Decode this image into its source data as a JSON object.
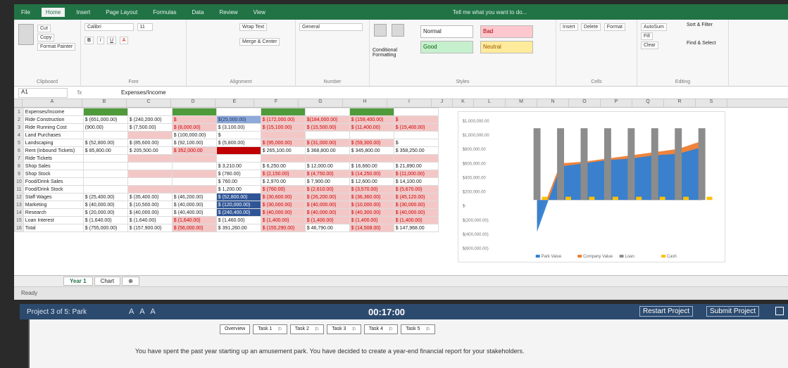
{
  "ribbon": {
    "tabs": [
      "File",
      "Home",
      "Insert",
      "Page Layout",
      "Formulas",
      "Data",
      "Review",
      "View"
    ],
    "tell_me": "Tell me what you want to do...",
    "clipboard": {
      "cut": "Cut",
      "copy": "Copy",
      "format_painter": "Format Painter",
      "label": "Clipboard"
    },
    "font": {
      "name": "Calibri",
      "size": "11",
      "label": "Font"
    },
    "alignment": {
      "wrap": "Wrap Text",
      "merge": "Merge & Center",
      "label": "Alignment"
    },
    "number": {
      "format": "General",
      "label": "Number"
    },
    "styles": {
      "conditional": "Conditional Formatting",
      "format_table": "Format as Table",
      "normal": "Normal",
      "bad": "Bad",
      "good": "Good",
      "neutral": "Neutral",
      "label": "Styles"
    },
    "cells": {
      "insert": "Insert",
      "delete": "Delete",
      "format": "Format",
      "label": "Cells"
    },
    "editing": {
      "autosum": "AutoSum",
      "fill": "Fill",
      "clear": "Clear",
      "sort": "Sort & Filter",
      "find": "Find & Select",
      "label": "Editing"
    }
  },
  "formula_bar": {
    "namebox": "A1",
    "fx": "fx",
    "content": "Expenses/Income"
  },
  "columns": [
    "A",
    "B",
    "C",
    "D",
    "E",
    "F",
    "G",
    "H",
    "I",
    "J",
    "K",
    "L",
    "M",
    "N",
    "O",
    "P",
    "Q",
    "R",
    "S"
  ],
  "sheet_rows": [
    {
      "n": "1",
      "label": "Expenses/Income",
      "cells": [
        "",
        "",
        "",
        "",
        "",
        "",
        "",
        ""
      ]
    },
    {
      "n": "2",
      "label": "Ride Construction",
      "cells": [
        "$ (651,000.00)",
        "$ (240,200.00)",
        "$",
        "$(25,000.00)",
        "$ (172,000.00)",
        "$(184,000.00)",
        "$ (159,400.00)",
        "$"
      ]
    },
    {
      "n": "3",
      "label": "Ride Running Cost",
      "cells": [
        "(900.00)",
        "$ (7,500.00)",
        "$ (8,000.00)",
        "$ (3,100.00)",
        "$ (15,100.00)",
        "$ (15,500.00)",
        "$ (11,400.00)",
        "$ (15,400.00)"
      ]
    },
    {
      "n": "4",
      "label": "Land Purchases",
      "cells": [
        "",
        "",
        "$ (100,000.00)",
        "$",
        "",
        "",
        "",
        ""
      ]
    },
    {
      "n": "5",
      "label": "Landscaping",
      "cells": [
        "$ (52,800.00)",
        "$ (85,600.00)",
        "$ (92,100.00)",
        "$ (5,800.00)",
        "$ (95,000.00)",
        "$ (31,000.00)",
        "$ (59,300.00)",
        "$"
      ]
    },
    {
      "n": "6",
      "label": "Rent (Inbound Tickets)",
      "cells": [
        "$ 85,800.00",
        "$ 205,500.00",
        "$ 352,000.00",
        "",
        "$ 265,100.00",
        "$ 368,800.00",
        "$ 345,800.00",
        "$ 358,250.00"
      ]
    },
    {
      "n": "7",
      "label": "Ride Tickets",
      "cells": [
        "",
        "",
        "",
        "",
        "",
        "",
        "",
        ""
      ]
    },
    {
      "n": "8",
      "label": "Shop Sales",
      "cells": [
        "",
        "",
        "",
        "$ 3,210.00",
        "$ 6,250.00",
        "$ 12,000.00",
        "$ 16,660.00",
        "$ 21,890.00"
      ]
    },
    {
      "n": "9",
      "label": "Shop Stock",
      "cells": [
        "",
        "",
        "",
        "$ (780.00)",
        "$ (2,150.00)",
        "$ (4,750.00)",
        "$ (14,250.00)",
        "$ (11,000.00)"
      ]
    },
    {
      "n": "10",
      "label": "Food/Drink Sales",
      "cells": [
        "",
        "",
        "",
        "$ 760.00",
        "$ 2,970.00",
        "$ 7,900.00",
        "$ 12,600.00",
        "$ 14,100.00"
      ]
    },
    {
      "n": "11",
      "label": "Food/Drink Stock",
      "cells": [
        "",
        "",
        "",
        "$ 1,200.00",
        "$ (760.00)",
        "$ (2,610.00)",
        "$ (3,570.00)",
        "$ (5,670.00)"
      ]
    },
    {
      "n": "12",
      "label": "Staff Wages",
      "cells": [
        "$ (25,400.00)",
        "$ (35,400.00)",
        "$ (46,200.00)",
        "$ (52,800.00)",
        "$ (30,600.00)",
        "$ (26,200.00)",
        "$ (36,360.00)",
        "$ (45,120.00)"
      ]
    },
    {
      "n": "13",
      "label": "Marketing",
      "cells": [
        "$ (40,000.00)",
        "$ (10,500.00)",
        "$ (40,000.00)",
        "$ (120,000.00)",
        "$ (30,000.00)",
        "$ (40,000.00)",
        "$ (10,000.00)",
        "$ (30,000.00)"
      ]
    },
    {
      "n": "14",
      "label": "Research",
      "cells": [
        "$ (20,000.00)",
        "$ (40,000.00)",
        "$ (40,400.00)",
        "$ (240,400.00)",
        "$ (40,000.00)",
        "$ (40,000.00)",
        "$ (40,300.00)",
        "$ (40,000.00)"
      ]
    },
    {
      "n": "15",
      "label": "Loan Interest",
      "cells": [
        "$ (1,640.00)",
        "$ (1,640.00)",
        "$ (1,640.00)",
        "$ (1,460.00)",
        "$ (1,400.00)",
        "$ (1,400.00)",
        "$ (1,400.00)",
        "$ (1,400.00)"
      ]
    },
    {
      "n": "16",
      "label": "Total",
      "cells": [
        "$ (755,000.00)",
        "$ (157,900.00)",
        "$ (56,000.00)",
        "$ 391,260.00",
        "$ (155,290.00)",
        "$ 46,790.00",
        "$ (14,508.00)",
        "$ 147,968.00"
      ]
    }
  ],
  "chart_data": {
    "type": "bar",
    "y_ticks": [
      "$1,000,000.00",
      "$1,000,000.00",
      "$800,000.00",
      "$600,000.00",
      "$400,000.00",
      "$200,000.00",
      "$-",
      "$(200,000.00)",
      "$(400,000.00)",
      "$(600,000.00)"
    ],
    "legend": [
      "Park Value",
      "Company Value",
      "Loan",
      "Cash"
    ],
    "categories": [
      "1",
      "2",
      "3",
      "4",
      "5",
      "6",
      "7",
      "8"
    ],
    "series": [
      {
        "name": "Park Value",
        "values": [
          -400000,
          420000,
          460000,
          500000,
          520000,
          560000,
          580000,
          660000
        ]
      },
      {
        "name": "Company Value",
        "values": [
          -300000,
          460000,
          480000,
          520000,
          560000,
          600000,
          640000,
          740000
        ]
      },
      {
        "name": "Loan",
        "values": [
          900000,
          900000,
          900000,
          900000,
          900000,
          900000,
          900000,
          900000
        ]
      },
      {
        "name": "Cash",
        "values": [
          40000,
          40000,
          40000,
          40000,
          40000,
          40000,
          40000,
          40000
        ]
      }
    ],
    "ylim": [
      -600000,
      1000000
    ],
    "colors": {
      "Park Value": "#2f7fd4",
      "Company Value": "#ed7d31",
      "Loan": "#8c8c8c",
      "Cash": "#ffc000"
    }
  },
  "sheet_tabs": [
    "Year 1",
    "Chart"
  ],
  "status": "Ready",
  "project": {
    "title": "Project 3 of 5: Park",
    "font_sizes": "A A A",
    "timer": "00:17:00",
    "restart": "Restart Project",
    "submit": "Submit Project",
    "tasks": [
      "Overview",
      "Task 1",
      "Task 2",
      "Task 3",
      "Task 4",
      "Task 5"
    ],
    "description": "You have spent the past year starting up an amusement park. You have decided to create a year-end financial report for your stakeholders."
  }
}
